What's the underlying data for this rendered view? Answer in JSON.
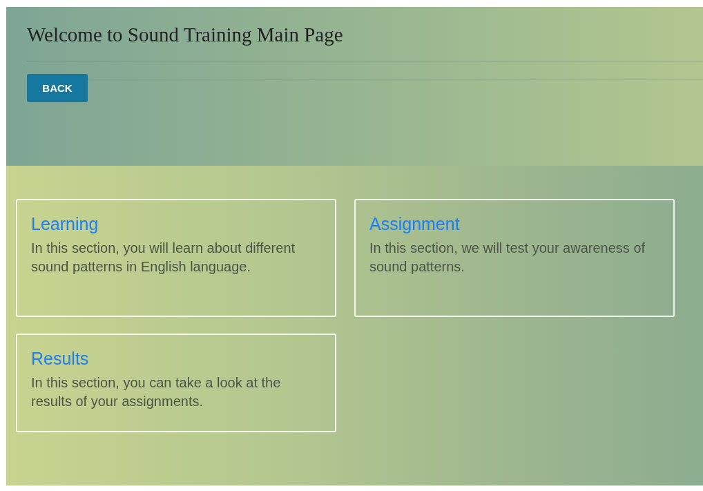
{
  "header": {
    "title": "Welcome to Sound Training Main Page",
    "back_button": "BACK"
  },
  "sections": [
    {
      "title": "Learning",
      "description": "In this section, you will learn about different sound patterns in English language."
    },
    {
      "title": "Assignment",
      "description": "In this section, we will test your awareness of sound patterns."
    },
    {
      "title": "Results",
      "description": "In this section, you can take a look at the results of your assignments."
    }
  ]
}
